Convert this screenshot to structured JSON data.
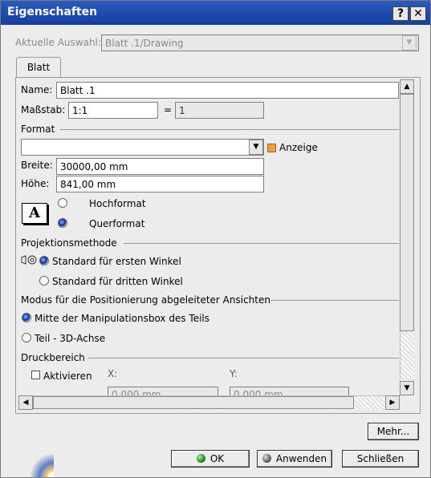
{
  "window": {
    "title": "Eigenschaften",
    "help_btn": "?",
    "close_btn": "✕"
  },
  "selection": {
    "label": "Aktuelle Auswahl:",
    "value": "Blatt .1/Drawing"
  },
  "tab": {
    "label": "Blatt"
  },
  "sheet": {
    "name_label": "Name:",
    "name_value": "Blatt .1",
    "scale_label": "Maßstab:",
    "scale_value": "1:1",
    "equals": "=",
    "scale_result": "1"
  },
  "format": {
    "section": "Format",
    "dropdown_value": "",
    "show_label": "Anzeige",
    "width_label": "Breite:",
    "width_value": "30000,00 mm",
    "height_label": "Höhe:",
    "height_value": "841,00 mm",
    "portrait_label": "Hochformat",
    "landscape_label": "Querformat",
    "orientation_icon_glyph": "A"
  },
  "projection": {
    "section": "Projektionsmethode",
    "first_angle": "Standard für ersten Winkel",
    "third_angle": "Standard für dritten Winkel"
  },
  "positioning": {
    "section": "Modus für die Positionierung abgeleiteter Ansichten",
    "option1": "Mitte der Manipulationsbox des Teils",
    "option2": "Teil - 3D-Achse"
  },
  "print_area": {
    "section": "Druckbereich",
    "activate_label": "Aktivieren",
    "x_label": "X:",
    "y_label": "Y:",
    "x_value": "0,000 mm",
    "y_value": "0,000 mm"
  },
  "buttons": {
    "more": "Mehr...",
    "ok": "OK",
    "apply": "Anwenden",
    "close": "Schließen"
  },
  "icons": {
    "dropdown": "▼",
    "scroll_up": "▲",
    "scroll_down": "▼",
    "scroll_left": "◀",
    "scroll_right": "▶"
  },
  "colors": {
    "titlebar": "#1f4fb0",
    "ok_dot": "#1c8a1c",
    "orange_check": "#f0a040"
  }
}
